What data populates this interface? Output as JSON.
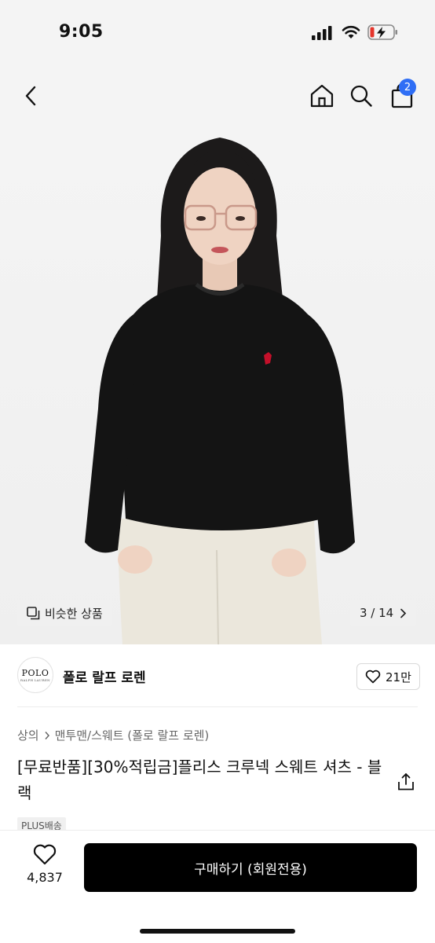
{
  "status_bar": {
    "time": "9:05"
  },
  "nav": {
    "cart_count": "2"
  },
  "gallery": {
    "similar_label": "비슷한 상품",
    "page_indicator": "3 / 14"
  },
  "brand": {
    "logo_text": "POLO",
    "logo_subtext": "RALPH LAUREN",
    "name": "폴로 랄프 로렌",
    "like_count": "21만"
  },
  "product": {
    "breadcrumb_category": "상의",
    "breadcrumb_subcategory": "맨투맨/스웨트 (폴로 랄프 로렌)",
    "title": "[무료반품][30%적립금]플리스 크루넥 스웨트 셔츠 - 블랙",
    "shipping_badge": "PLUS배송"
  },
  "bottom_bar": {
    "wish_count": "4,837",
    "buy_label": "구매하기 (회원전용)"
  },
  "colors": {
    "accent_blue": "#2f6ef5",
    "buy_button": "#000000",
    "logo_pony": "#c4102a"
  }
}
